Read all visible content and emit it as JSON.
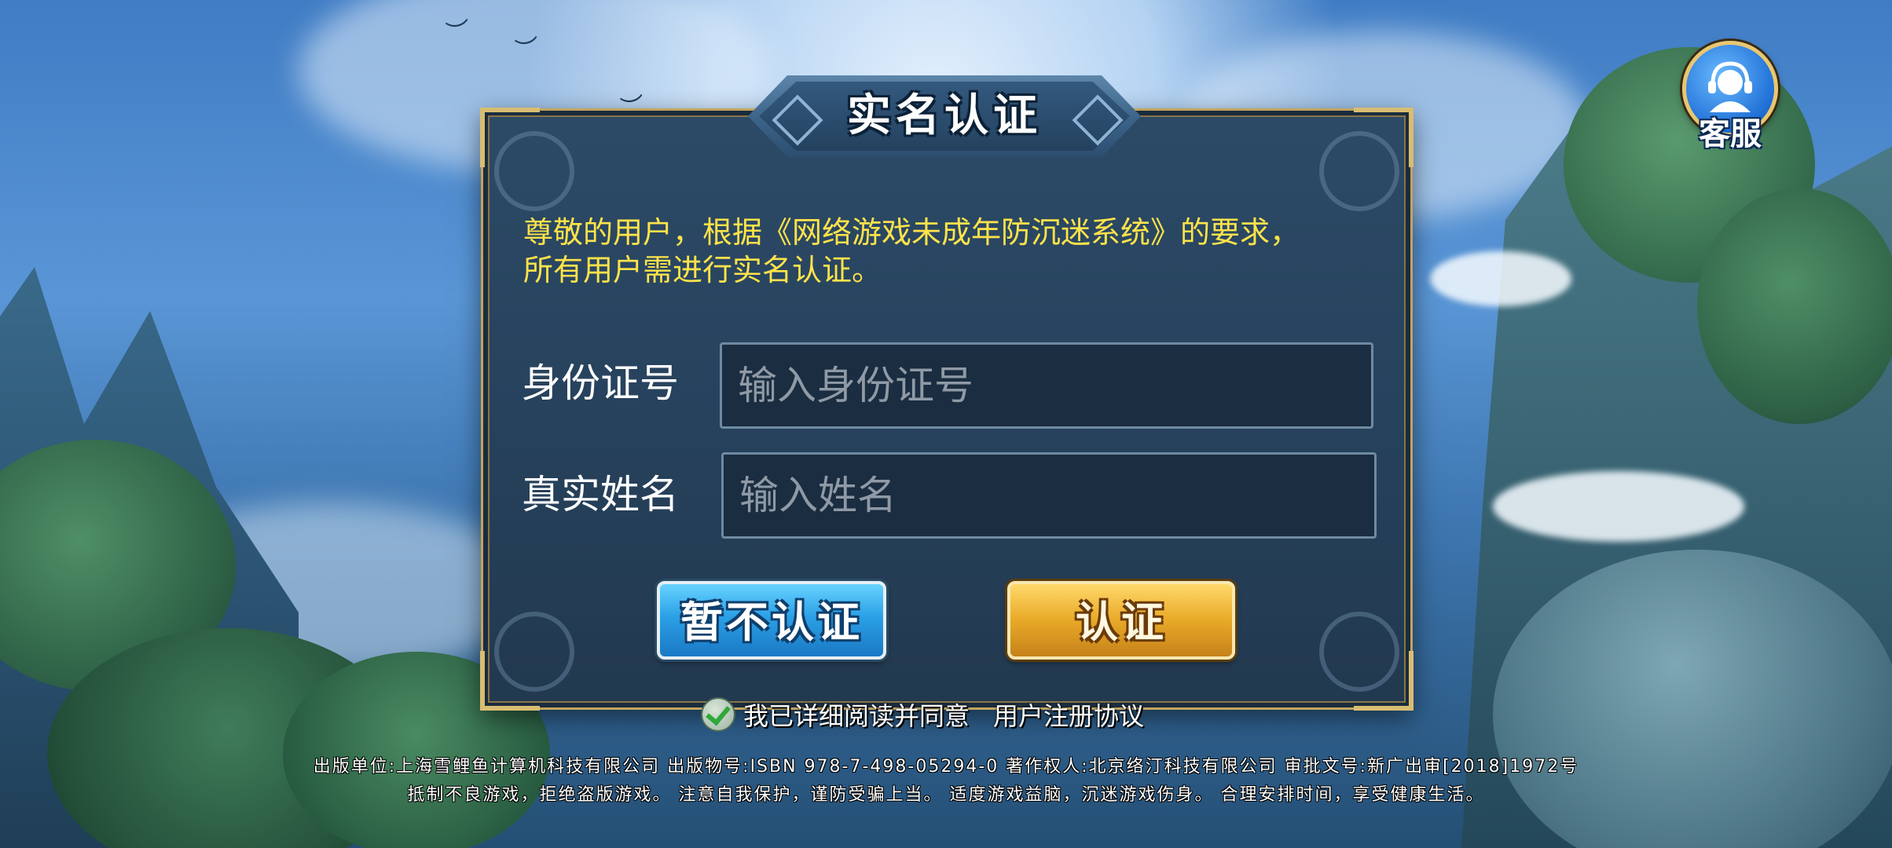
{
  "dialog": {
    "title": "实名认证",
    "notice_line1": "尊敬的用户，根据《网络游戏未成年防沉迷系统》的要求，",
    "notice_line2": "所有用户需进行实名认证。",
    "id_label": "身份证号",
    "id_placeholder": "输入身份证号",
    "name_label": "真实姓名",
    "name_placeholder": "输入姓名",
    "skip_button": "暂不认证",
    "verify_button": "认证"
  },
  "agreement": {
    "checked": true,
    "text": "我已详细阅读并同意",
    "link": "用户注册协议"
  },
  "support": {
    "label": "客服"
  },
  "footer": {
    "line1": "出版单位:上海雪鲤鱼计算机科技有限公司  出版物号:ISBN 978-7-498-05294-0  著作权人:北京络汀科技有限公司  审批文号:新广出审[2018]1972号",
    "line2": "抵制不良游戏，拒绝盗版游戏。 注意自我保护，谨防受骗上当。 适度游戏益脑，沉迷游戏伤身。 合理安排时间，享受健康生活。"
  },
  "colors": {
    "notice": "#ffe34a",
    "skip_button": "#2ba0e6",
    "verify_button": "#e8a928",
    "dialog_bg": "#2c4a66"
  }
}
